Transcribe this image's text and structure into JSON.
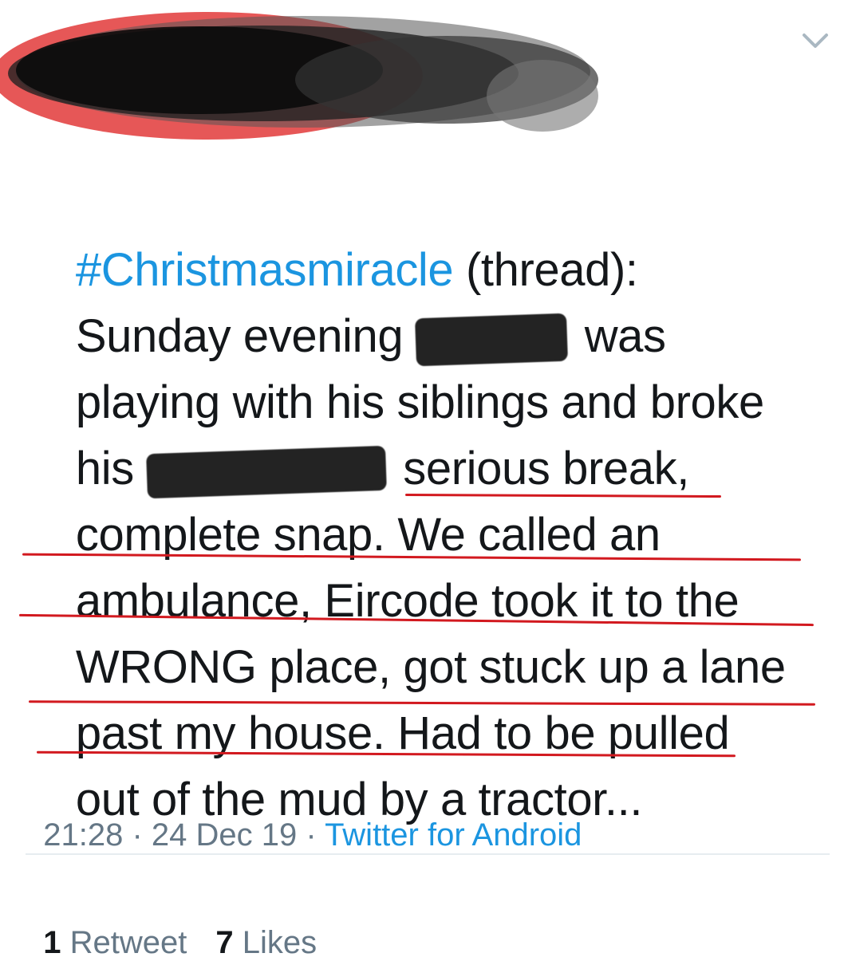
{
  "tweet": {
    "text_lines": [
      {
        "hashtag": "#Christmasmiracle",
        "rest": " (thread):"
      },
      {
        "before": "Sunday evening ",
        "after": " was"
      },
      {
        "text": "playing with his siblings and broke"
      },
      {
        "before": "his ",
        "after": " serious break,"
      },
      {
        "text": "complete snap. We called an"
      },
      {
        "text": "ambulance, Eircode took it to the"
      },
      {
        "text": "WRONG place, got stuck up a lane"
      },
      {
        "text": "past my house. Had to be pulled"
      },
      {
        "text": "out of the mud by a tractor..."
      }
    ],
    "time": "21:28",
    "date": "24 Dec 19",
    "separator": " · ",
    "source": "Twitter for Android"
  },
  "stats": {
    "retweets_count": "1",
    "retweets_label": " Retweet",
    "likes_count": "7",
    "likes_label": " Likes"
  },
  "colors": {
    "link": "#1b95e0",
    "text": "#14171a",
    "muted": "#657786",
    "annotation": "#d2191f"
  },
  "icons": {
    "menu": "chevron-down-icon"
  }
}
